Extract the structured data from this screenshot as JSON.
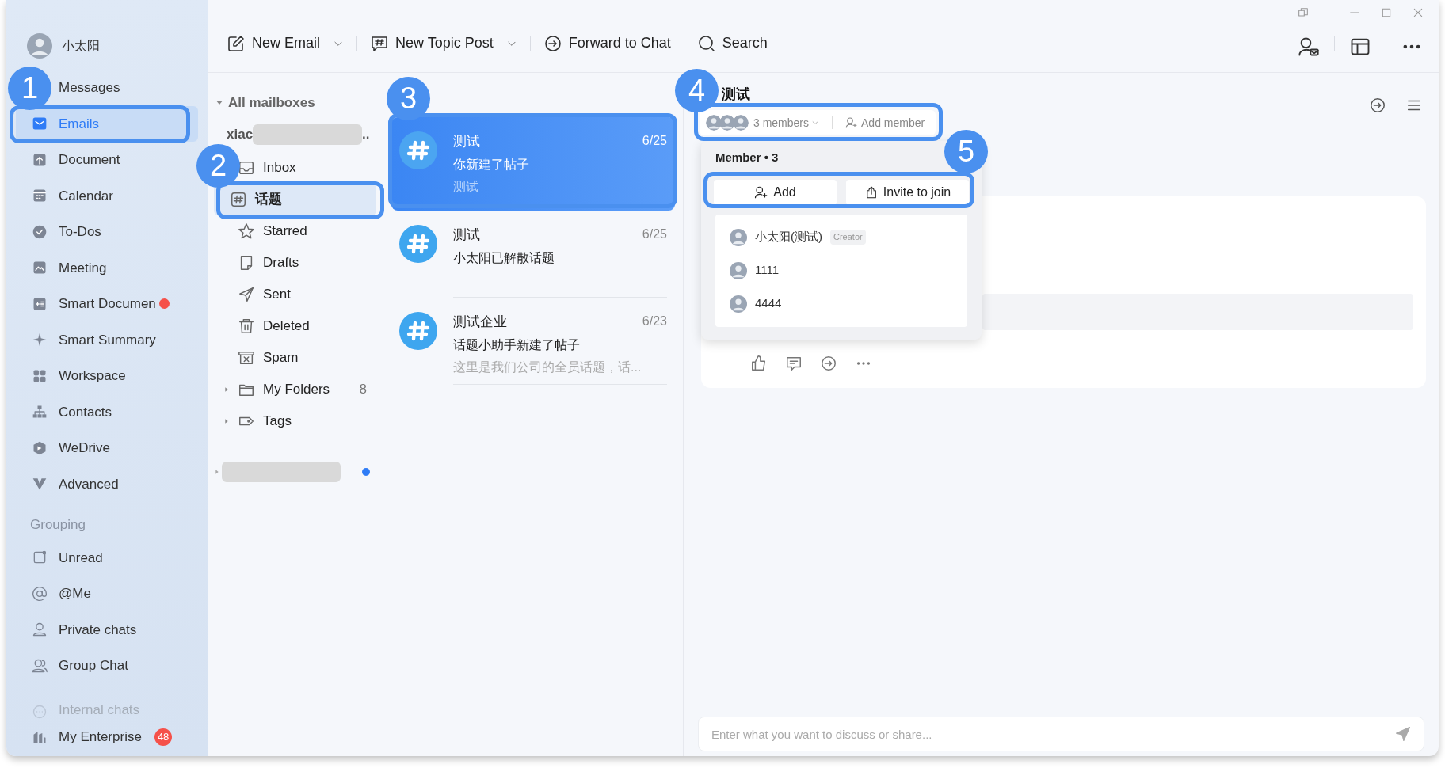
{
  "user": {
    "name": "小太阳"
  },
  "nav": [
    {
      "label": "Messages",
      "selected": false,
      "dot": false
    },
    {
      "label": "Emails",
      "selected": true,
      "dot": false
    },
    {
      "label": "Document",
      "selected": false,
      "dot": false
    },
    {
      "label": "Calendar",
      "selected": false,
      "dot": false
    },
    {
      "label": "To-Dos",
      "selected": false,
      "dot": false
    },
    {
      "label": "Meeting",
      "selected": false,
      "dot": false
    },
    {
      "label": "Smart Documen",
      "selected": false,
      "dot": true
    },
    {
      "label": "Smart Summary",
      "selected": false,
      "dot": false
    },
    {
      "label": "Workspace",
      "selected": false,
      "dot": false
    },
    {
      "label": "Contacts",
      "selected": false,
      "dot": false
    },
    {
      "label": "WeDrive",
      "selected": false,
      "dot": false
    },
    {
      "label": "Advanced",
      "selected": false,
      "dot": false
    }
  ],
  "grouping": {
    "title": "Grouping",
    "items": [
      {
        "label": "Unread"
      },
      {
        "label": "@Me"
      },
      {
        "label": "Private chats"
      },
      {
        "label": "Group Chat"
      },
      {
        "label": "Internal chats"
      }
    ]
  },
  "enterprise": {
    "label": "My Enterprise",
    "badge": "48"
  },
  "toolbar": [
    {
      "label": "New Email",
      "dropdown": true
    },
    {
      "label": "New Topic Post",
      "dropdown": true
    },
    {
      "label": "Forward to Chat",
      "dropdown": false
    },
    {
      "label": "Search",
      "dropdown": false
    }
  ],
  "mailboxes": {
    "title": "All mailboxes",
    "expanded": true,
    "account": "xiac",
    "account_suffix": "..",
    "folders": [
      {
        "label": "Inbox",
        "selected": false,
        "has_children": false
      },
      {
        "label": "话题",
        "selected": true,
        "has_children": false
      },
      {
        "label": "Starred",
        "selected": false,
        "has_children": false
      },
      {
        "label": "Drafts",
        "selected": false,
        "has_children": false
      },
      {
        "label": "Sent",
        "selected": false,
        "has_children": false
      },
      {
        "label": "Deleted",
        "selected": false,
        "has_children": false
      },
      {
        "label": "Spam",
        "selected": false,
        "has_children": false
      },
      {
        "label": "My Folders",
        "selected": false,
        "has_children": true,
        "count": "8"
      },
      {
        "label": "Tags",
        "selected": false,
        "has_children": true
      }
    ],
    "other_account": {
      "unread": true
    }
  },
  "threads": [
    {
      "title": "测试",
      "date": "6/25",
      "line": "你新建了帖子",
      "preview": "测试",
      "selected": true
    },
    {
      "title": "测试",
      "date": "6/25",
      "line": "小太阳已解散话题",
      "selected": false
    },
    {
      "title": "测试企业",
      "date": "6/23",
      "line": "话题小助手新建了帖子",
      "preview": "这里是我们公司的全员话题，话...",
      "selected": false
    }
  ],
  "detail": {
    "title": "测试",
    "members_label": "3 members",
    "add_member": "Add member",
    "popover": {
      "heading": "Member • 3",
      "add": "Add",
      "invite": "Invite to join",
      "members": [
        {
          "name": "小太阳(测试)",
          "tag": "Creator"
        },
        {
          "name": "1111"
        },
        {
          "name": "4444"
        }
      ]
    },
    "composer": {
      "placeholder": "Enter what you want to discuss or share..."
    }
  },
  "callouts": [
    {
      "number": "1"
    },
    {
      "number": "2"
    },
    {
      "number": "3"
    },
    {
      "number": "4"
    },
    {
      "number": "5"
    }
  ]
}
